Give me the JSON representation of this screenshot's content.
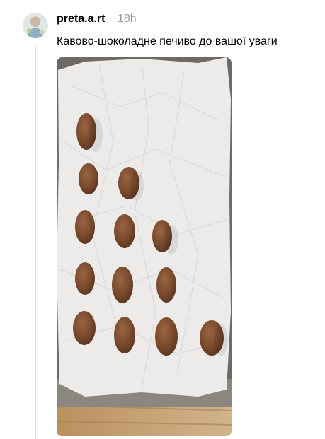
{
  "post": {
    "username": "preta.a.rt",
    "time": "18h",
    "caption": "Кавово-шоколадне печиво до вашої уваги",
    "image": {
      "subject": "cookies-on-baking-sheet",
      "cookie_count": 13
    }
  },
  "colors": {
    "username": "#000000",
    "time": "#999999",
    "thread_line": "#e6e6e6",
    "cookie": "#7a4a2c",
    "parchment": "#ecebea"
  }
}
